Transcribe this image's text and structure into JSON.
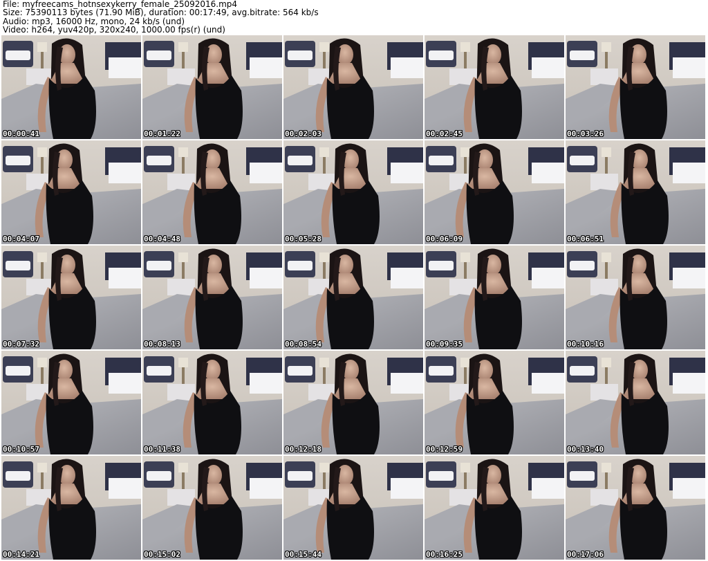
{
  "header": {
    "file_line": "File: myfreecams_hotnsexykerry_female_25092016.mp4",
    "size_line": "Size: 75390113 bytes (71.90 MiB), duration: 00:17:49, avg.bitrate: 564 kb/s",
    "audio_line": "Audio: mp3, 16000 Hz, mono, 24 kb/s (und)",
    "video_line": "Video: h264, yuv420p, 320x240, 1000.00 fps(r) (und)"
  },
  "thumbnails": [
    {
      "timestamp": "00:00:41"
    },
    {
      "timestamp": "00:01:22"
    },
    {
      "timestamp": "00:02:03"
    },
    {
      "timestamp": "00:02:45"
    },
    {
      "timestamp": "00:03:26"
    },
    {
      "timestamp": "00:04:07"
    },
    {
      "timestamp": "00:04:48"
    },
    {
      "timestamp": "00:05:28"
    },
    {
      "timestamp": "00:06:09"
    },
    {
      "timestamp": "00:06:51"
    },
    {
      "timestamp": "00:07:32"
    },
    {
      "timestamp": "00:08:13"
    },
    {
      "timestamp": "00:08:54"
    },
    {
      "timestamp": "00:09:35"
    },
    {
      "timestamp": "00:10:16"
    },
    {
      "timestamp": "00:10:57"
    },
    {
      "timestamp": "00:11:38"
    },
    {
      "timestamp": "00:12:18"
    },
    {
      "timestamp": "00:12:59"
    },
    {
      "timestamp": "00:13:40"
    },
    {
      "timestamp": "00:14:21"
    },
    {
      "timestamp": "00:15:02"
    },
    {
      "timestamp": "00:15:44"
    },
    {
      "timestamp": "00:16:25"
    },
    {
      "timestamp": "00:17:06"
    }
  ]
}
